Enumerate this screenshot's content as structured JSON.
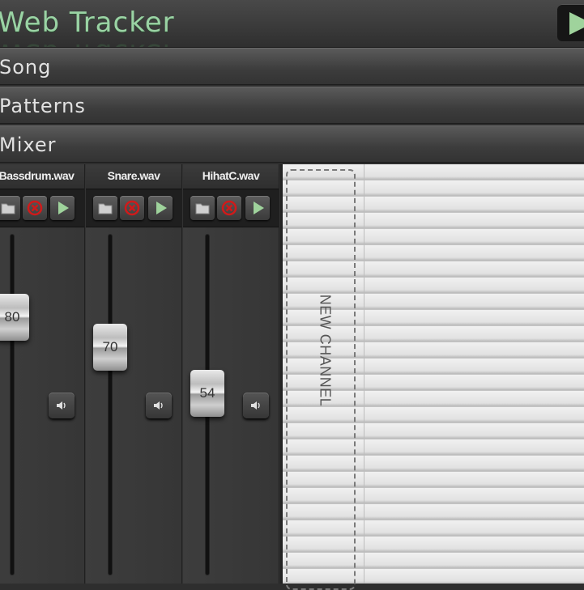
{
  "header": {
    "title": "Web Tracker",
    "play_icon": "play-triangle"
  },
  "sections": {
    "song": "Song",
    "patterns": "Patterns",
    "mixer": "Mixer"
  },
  "mixer": {
    "channels": [
      {
        "name": "Bassdrum.wav",
        "volume": 80
      },
      {
        "name": "Snare.wav",
        "volume": 70
      },
      {
        "name": "HihatC.wav",
        "volume": 54
      }
    ],
    "tools": {
      "open_icon": "folder-icon",
      "remove_icon": "remove-icon",
      "play_icon": "play-icon",
      "mute_icon": "speaker-icon"
    },
    "new_channel_label": "NEW CHANNEL"
  },
  "colors": {
    "title": "#9ad3a4",
    "play": "#9fd39c",
    "remove": "#d01a1a"
  }
}
